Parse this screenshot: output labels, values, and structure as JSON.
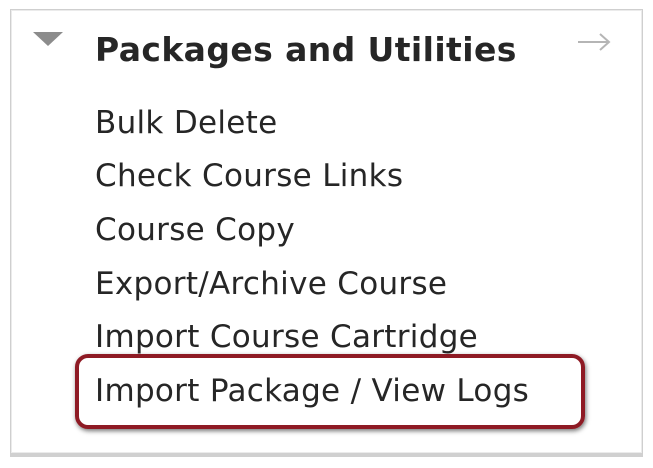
{
  "panel": {
    "title": "Packages and Utilities",
    "collapse_icon": "triangle-down-icon",
    "expand_icon": "arrow-right-icon",
    "items": [
      {
        "label": "Bulk Delete"
      },
      {
        "label": "Check Course Links"
      },
      {
        "label": "Course Copy"
      },
      {
        "label": "Export/Archive Course"
      },
      {
        "label": "Import Course Cartridge"
      },
      {
        "label": "Import Package / View Logs",
        "highlighted": true
      }
    ]
  },
  "colors": {
    "highlight_border": "#8e1a24",
    "text": "#262626",
    "icon": "#8c8c8c"
  }
}
